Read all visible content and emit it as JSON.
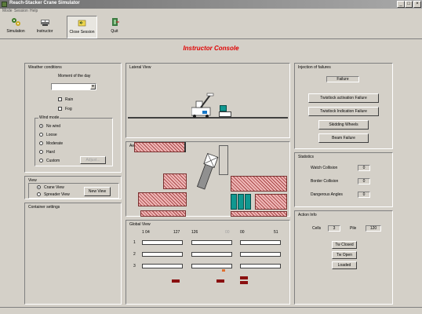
{
  "window": {
    "title": "Reach-Stacker Crane Simulator"
  },
  "menu": [
    "Mode",
    "Session",
    "Help"
  ],
  "toolbar": {
    "buttons": [
      {
        "label": "Simulation",
        "icon": "simulation-icon"
      },
      {
        "label": "Instructor",
        "icon": "instructor-icon"
      },
      {
        "label": "Close Session",
        "icon": "close-session-icon"
      },
      {
        "label": "Quit",
        "icon": "quit-icon"
      }
    ]
  },
  "console_title": "Instructor Console",
  "weather": {
    "title": "Weather conditions",
    "moment_label": "Moment of the day",
    "moment_value": "",
    "rain_label": "Rain",
    "fog_label": "Fog",
    "wind_title": "Wind mode",
    "wind_options": [
      "No wind",
      "Loose",
      "Moderate",
      "Hard",
      "Custom"
    ],
    "wind_selected": "No wind",
    "adjust_label": "Adjust..."
  },
  "view": {
    "title": "View",
    "options": [
      "Crane View",
      "Spreader View"
    ],
    "selected": "Crane View",
    "new_view_label": "New View"
  },
  "container_settings": {
    "title": "Container settings"
  },
  "lateral_view": {
    "title": "Lateral View"
  },
  "aerial_view": {
    "title": "Aerial View"
  },
  "global_view": {
    "title": "Global View",
    "columns": [
      "1 04",
      "127",
      "126",
      "00",
      "00",
      "51"
    ],
    "rows": [
      "1",
      "2",
      "3"
    ]
  },
  "failures": {
    "title": "Injection of failures",
    "status": "Failure",
    "buttons": [
      "Twistlock activation Failure",
      "Twistlock Indication Failure",
      "Skidding Wheels",
      "Beam Failure"
    ]
  },
  "statistics": {
    "title": "Statistics",
    "items": [
      {
        "label": "Watch Collision",
        "value": "0"
      },
      {
        "label": "Border Collision",
        "value": "0"
      },
      {
        "label": "Dangerous Angles",
        "value": "0"
      }
    ]
  },
  "action_info": {
    "title": "Action Info",
    "cells_label": "Cells",
    "cells_value": "3",
    "pile_label": "Pile",
    "pile_value": "120",
    "buttons": [
      "Tw Closed",
      "Tw Open",
      "Loaded"
    ]
  },
  "colors": {
    "accent": "#e00000",
    "container_hatch": "#a84848",
    "container_teal": "#109890",
    "marker": "#8a1010"
  }
}
